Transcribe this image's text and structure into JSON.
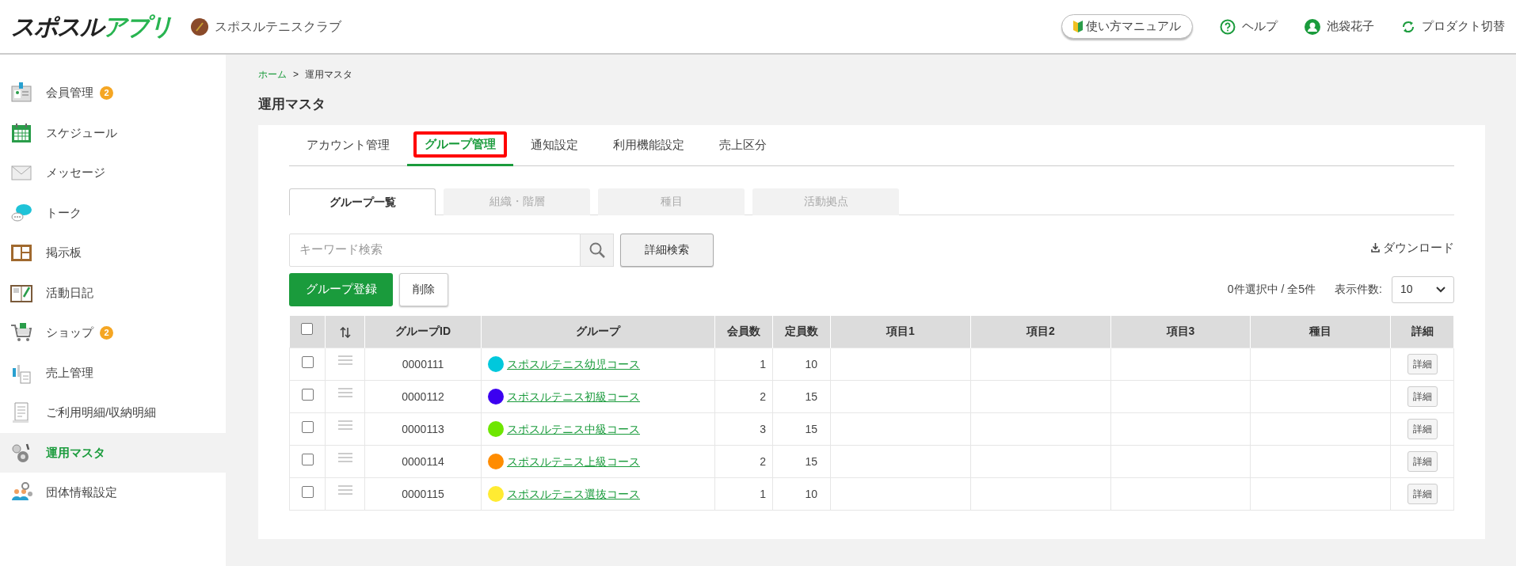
{
  "header": {
    "logo": [
      {
        "text": "スポスル",
        "kind": "dark"
      },
      {
        "text": "アプリ",
        "kind": "accent"
      }
    ],
    "club_name": "スポスルテニスクラブ",
    "manual_button": "使い方マニュアル",
    "help": "ヘルプ",
    "user": "池袋花子",
    "product_switch": "プロダクト切替"
  },
  "sidebar": {
    "items": [
      {
        "label": "会員管理",
        "badge": "2",
        "selected": false
      },
      {
        "label": "スケジュール",
        "selected": false
      },
      {
        "label": "メッセージ",
        "selected": false
      },
      {
        "label": "トーク",
        "selected": false
      },
      {
        "label": "掲示板",
        "selected": false
      },
      {
        "label": "活動日記",
        "selected": false
      },
      {
        "label": "ショップ",
        "badge": "2",
        "selected": false
      },
      {
        "label": "売上管理",
        "selected": false
      },
      {
        "label": "ご利用明細/収納明細",
        "selected": false
      },
      {
        "label": "運用マスタ",
        "selected": true
      },
      {
        "label": "団体情報設定",
        "selected": false
      }
    ]
  },
  "breadcrumb": [
    {
      "label": "ホーム",
      "kind": "link"
    },
    {
      "label": ">",
      "kind": "separator"
    },
    {
      "label": "運用マスタ",
      "kind": "current"
    }
  ],
  "page_title": "運用マスタ",
  "tabs": [
    {
      "label": "アカウント管理",
      "selected": false,
      "highlighted": false
    },
    {
      "label": "グループ管理",
      "selected": true,
      "highlighted": true
    },
    {
      "label": "通知設定",
      "selected": false,
      "highlighted": false
    },
    {
      "label": "利用機能設定",
      "selected": false,
      "highlighted": false
    },
    {
      "label": "売上区分",
      "selected": false,
      "highlighted": false
    }
  ],
  "subtabs": [
    {
      "label": "グループ一覧",
      "selected": true
    },
    {
      "label": "組織・階層",
      "selected": false
    },
    {
      "label": "種目",
      "selected": false
    },
    {
      "label": "活動拠点",
      "selected": false
    }
  ],
  "search": {
    "placeholder": "キーワード検索",
    "advanced_button": "詳細検索"
  },
  "download": "ダウンロード",
  "register_button": "グループ登録",
  "delete_button": "削除",
  "selection_count": "0件選択中 / 全5件",
  "page_size": {
    "label": "表示件数:",
    "value": "10"
  },
  "table": {
    "select_all_checked": false,
    "columns": [
      "グループID",
      "グループ",
      "会員数",
      "定員数",
      "項目1",
      "項目2",
      "項目3",
      "種目",
      "詳細"
    ],
    "rows": [
      {
        "checked": false,
        "id": "0000111",
        "group": "スポスルテニス幼児コース",
        "color": "#00c8dc",
        "members": "1",
        "capacity": "10",
        "detail": "詳細"
      },
      {
        "checked": false,
        "id": "0000112",
        "group": "スポスルテニス初級コース",
        "color": "#3c00f0",
        "members": "2",
        "capacity": "15",
        "detail": "詳細"
      },
      {
        "checked": false,
        "id": "0000113",
        "group": "スポスルテニス中級コース",
        "color": "#6ee600",
        "members": "3",
        "capacity": "15",
        "detail": "詳細"
      },
      {
        "checked": false,
        "id": "0000114",
        "group": "スポスルテニス上級コース",
        "color": "#ff8c00",
        "members": "2",
        "capacity": "15",
        "detail": "詳細"
      },
      {
        "checked": false,
        "id": "0000115",
        "group": "スポスルテニス選抜コース",
        "color": "#ffeb32",
        "members": "1",
        "capacity": "10",
        "detail": "詳細"
      }
    ]
  }
}
